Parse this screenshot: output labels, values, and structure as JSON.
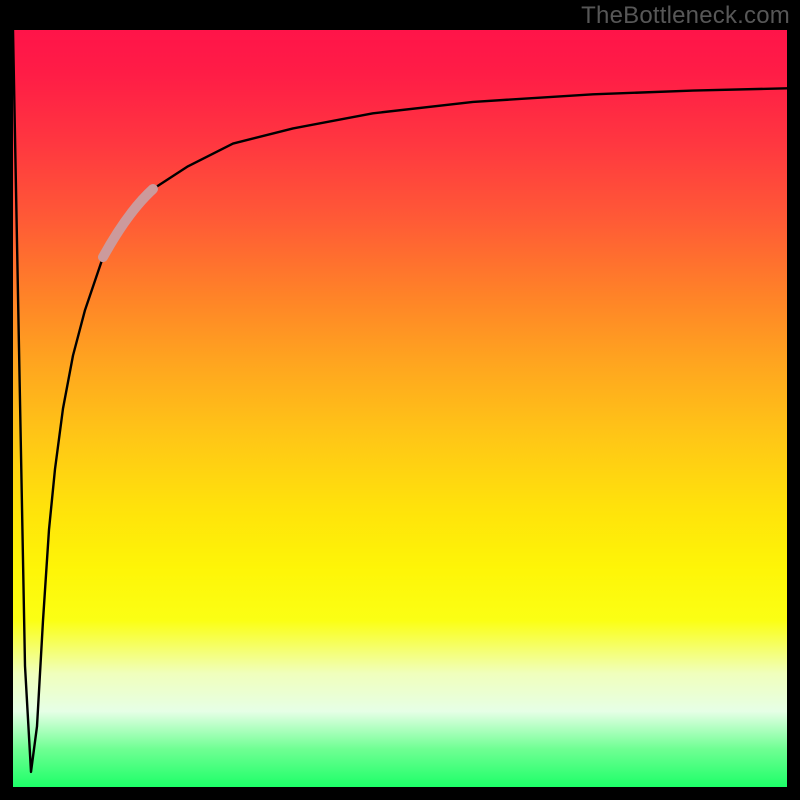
{
  "watermark": "TheBottleneck.com",
  "chart_data": {
    "type": "line",
    "title": "",
    "xlabel": "",
    "ylabel": "",
    "xlim": [
      0,
      774
    ],
    "ylim": [
      0,
      100
    ],
    "note": "Approximate curve of a bottleneck metric: a sharp plunge near x≈0 to ~0, then a steep rise that asymptotes near ~92 on the y-scale. Values estimated from pixels; no numeric axis ticks visible.",
    "series": [
      {
        "name": "bottleneck-curve",
        "x": [
          0,
          6,
          12,
          18,
          24,
          30,
          36,
          42,
          50,
          60,
          72,
          90,
          112,
          140,
          175,
          220,
          280,
          360,
          460,
          580,
          680,
          774
        ],
        "y": [
          100,
          58,
          16,
          2,
          8,
          22,
          34,
          42,
          50,
          57,
          63,
          70,
          75,
          79,
          82,
          85,
          87,
          89,
          90.5,
          91.5,
          92,
          92.3
        ]
      }
    ],
    "highlight_segment": {
      "name": "highlight",
      "x_start": 90,
      "x_end": 140,
      "y_start": 70,
      "y_end": 79,
      "stroke": "#cc9a9c"
    }
  }
}
